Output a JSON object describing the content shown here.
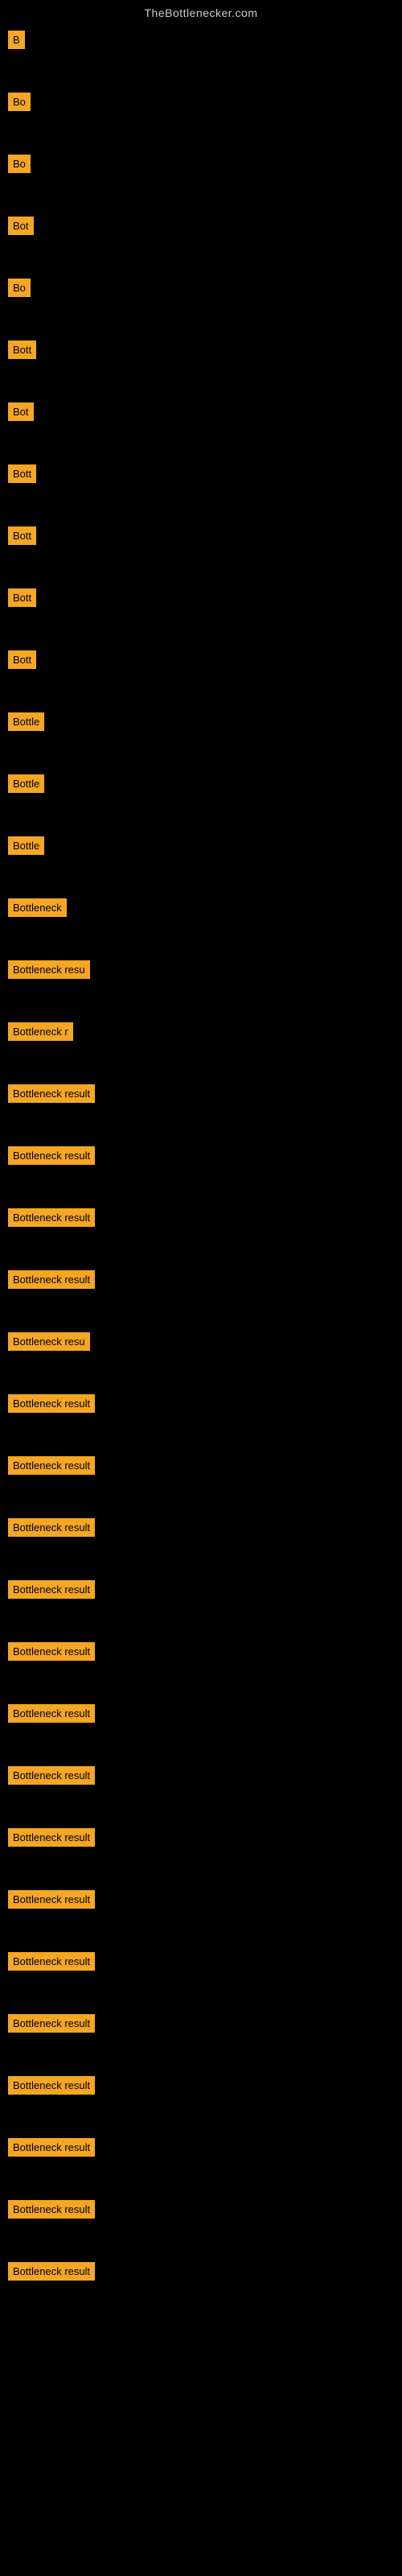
{
  "site": {
    "title": "TheBottlenecker.com"
  },
  "items": [
    {
      "label": "B"
    },
    {
      "label": "Bo"
    },
    {
      "label": "Bo"
    },
    {
      "label": "Bot"
    },
    {
      "label": "Bo"
    },
    {
      "label": "Bott"
    },
    {
      "label": "Bot"
    },
    {
      "label": "Bott"
    },
    {
      "label": "Bott"
    },
    {
      "label": "Bott"
    },
    {
      "label": "Bott"
    },
    {
      "label": "Bottle"
    },
    {
      "label": "Bottle"
    },
    {
      "label": "Bottle"
    },
    {
      "label": "Bottleneck"
    },
    {
      "label": "Bottleneck resu"
    },
    {
      "label": "Bottleneck r"
    },
    {
      "label": "Bottleneck result"
    },
    {
      "label": "Bottleneck result"
    },
    {
      "label": "Bottleneck result"
    },
    {
      "label": "Bottleneck result"
    },
    {
      "label": "Bottleneck resu"
    },
    {
      "label": "Bottleneck result"
    },
    {
      "label": "Bottleneck result"
    },
    {
      "label": "Bottleneck result"
    },
    {
      "label": "Bottleneck result"
    },
    {
      "label": "Bottleneck result"
    },
    {
      "label": "Bottleneck result"
    },
    {
      "label": "Bottleneck result"
    },
    {
      "label": "Bottleneck result"
    },
    {
      "label": "Bottleneck result"
    },
    {
      "label": "Bottleneck result"
    },
    {
      "label": "Bottleneck result"
    },
    {
      "label": "Bottleneck result"
    },
    {
      "label": "Bottleneck result"
    },
    {
      "label": "Bottleneck result"
    },
    {
      "label": "Bottleneck result"
    }
  ]
}
